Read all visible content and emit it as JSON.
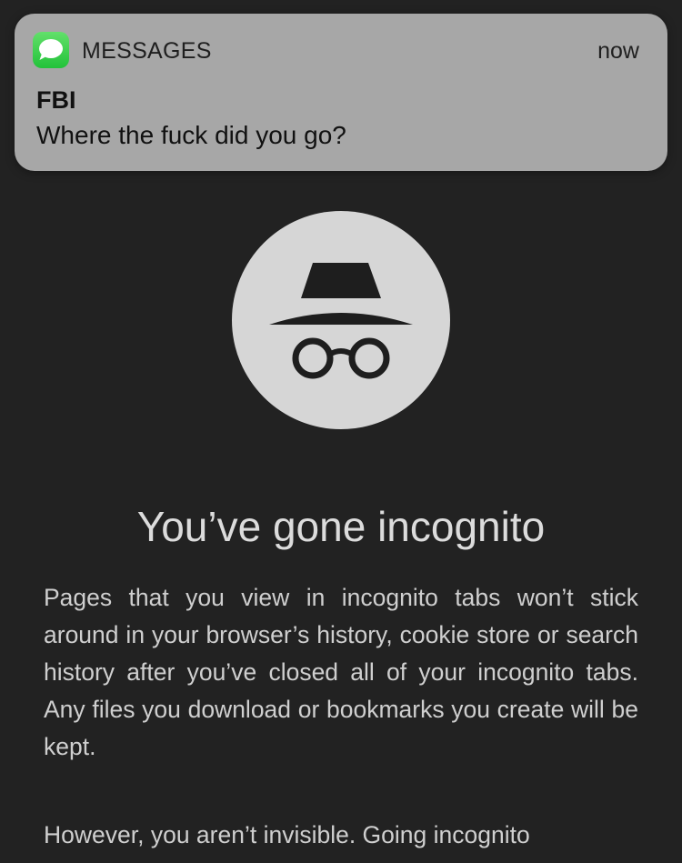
{
  "notification": {
    "app_icon": "messages-app-icon",
    "app_name": "MESSAGES",
    "time": "now",
    "sender": "FBI",
    "message": "Where the fuck did you go?"
  },
  "incognito": {
    "icon": "incognito-icon",
    "heading": "You’ve gone incognito",
    "paragraphs": [
      "Pages that you view in incognito tabs won’t stick around in your browser’s history, cookie store or search history after you’ve closed all of your incognito tabs. Any files you download or bookmarks you create will be kept.",
      "However, you aren’t invisible. Going incognito"
    ]
  },
  "colors": {
    "background": "#222222",
    "notification_bg": "#a7a7a7",
    "badge_bg": "#d6d6d6",
    "messages_green": "#34c759"
  }
}
